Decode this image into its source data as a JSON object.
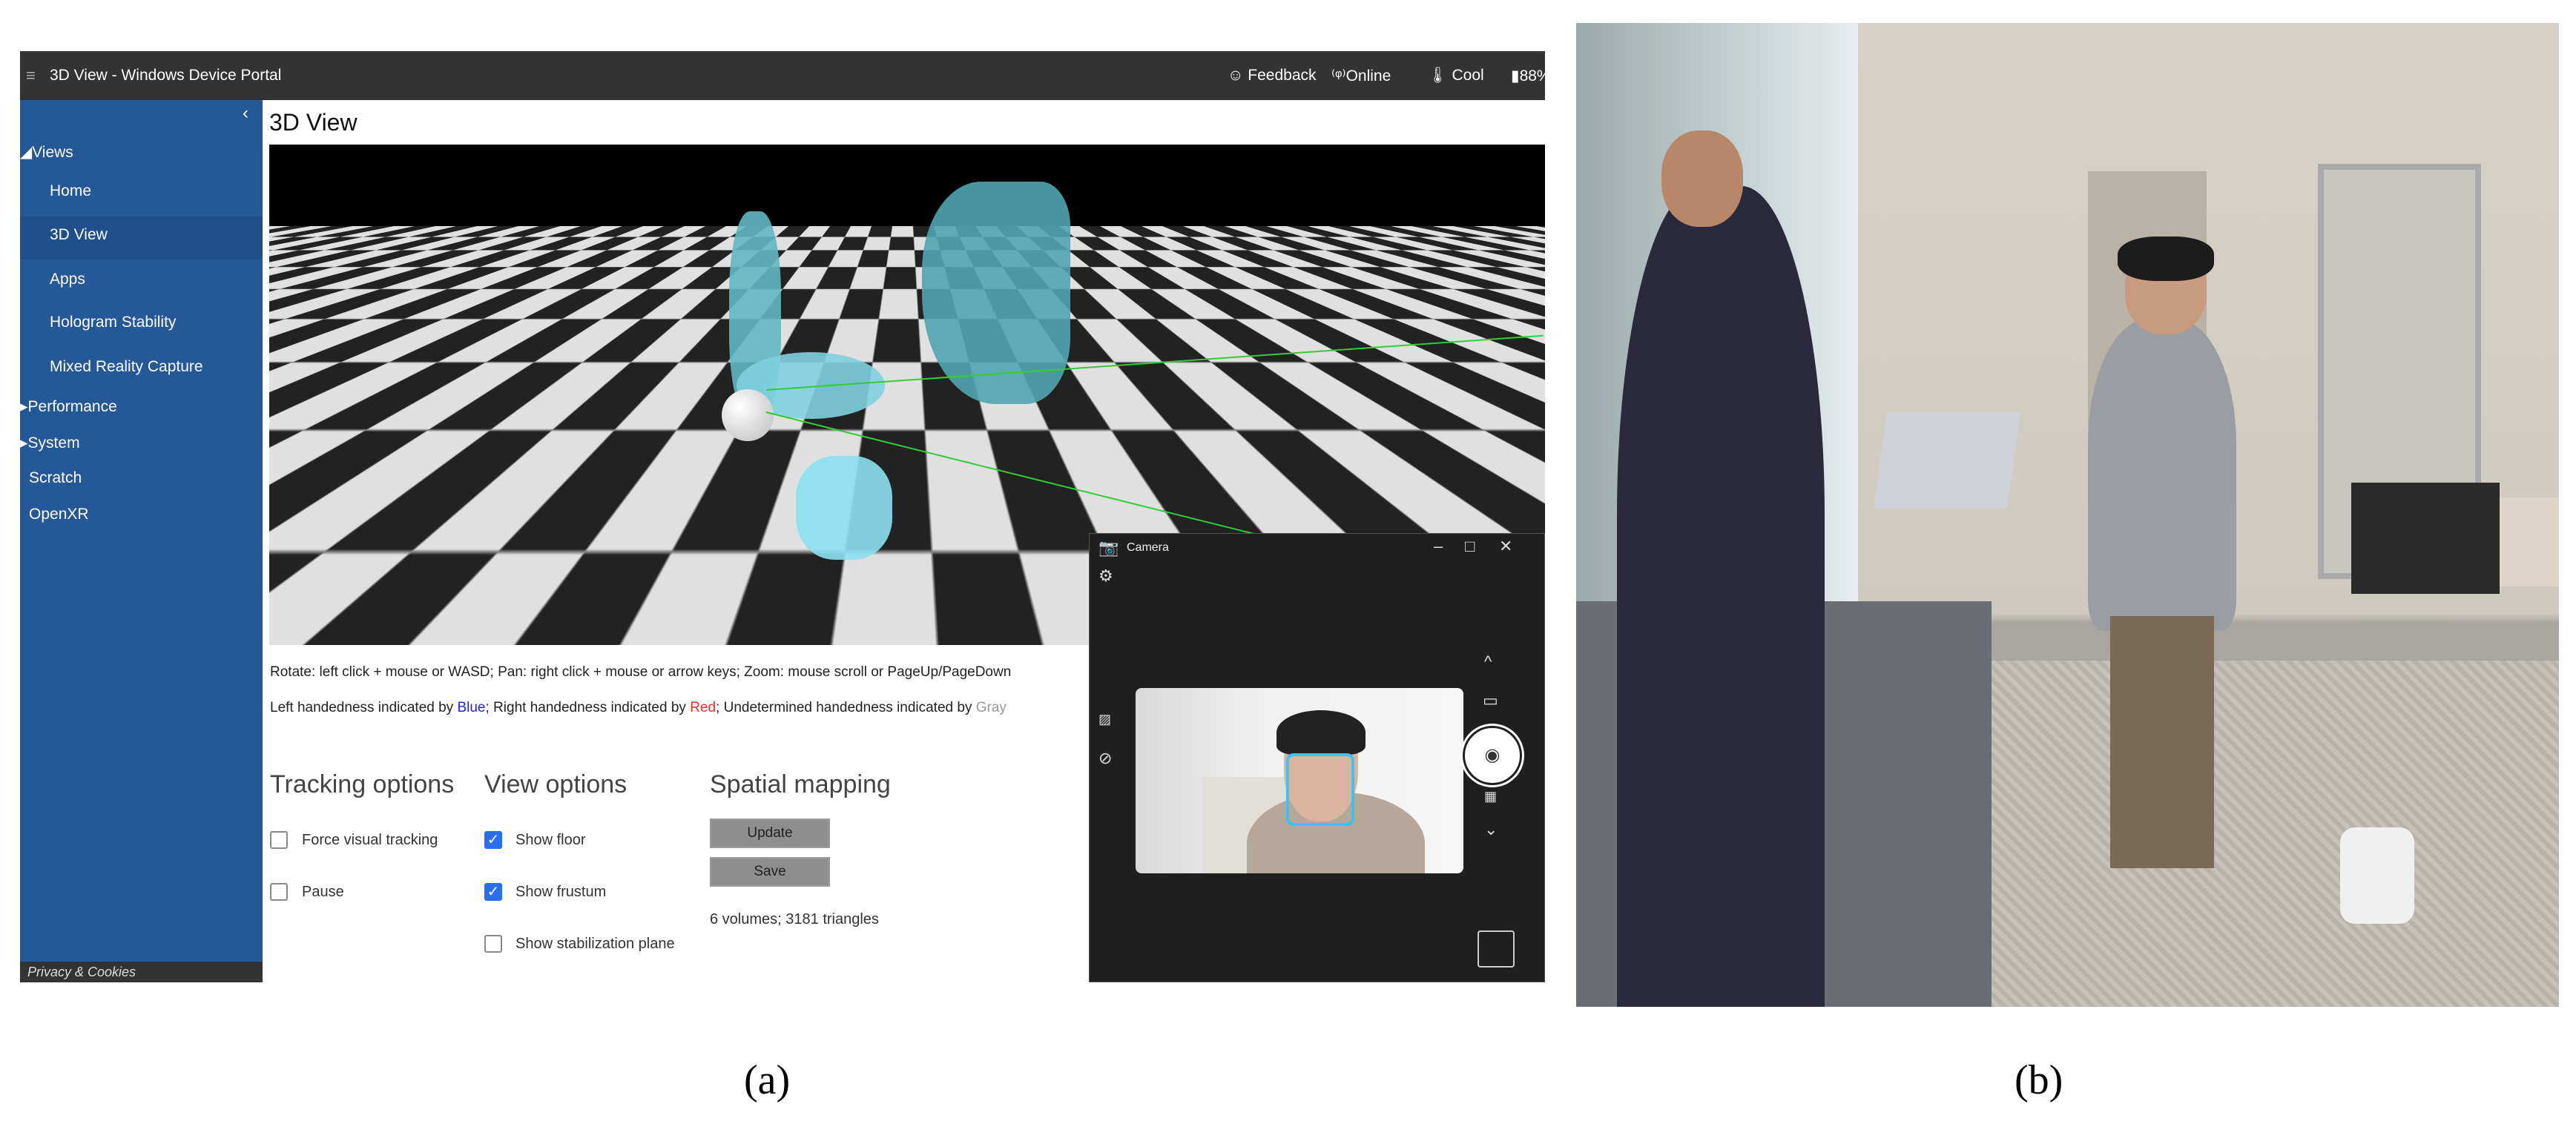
{
  "portal": {
    "title": "3D View - Windows Device Portal",
    "status": {
      "feedback": "Feedback",
      "online": "Online",
      "thermal": "Cool",
      "battery": "88%"
    },
    "sidebar": {
      "collapse_icon": "chevron-left-icon",
      "items": [
        {
          "label": "Views",
          "type": "group",
          "expanded": true
        },
        {
          "label": "Home"
        },
        {
          "label": "3D View",
          "selected": true
        },
        {
          "label": "Apps"
        },
        {
          "label": "Hologram Stability"
        },
        {
          "label": "Mixed Reality Capture"
        },
        {
          "label": "Performance",
          "type": "group",
          "expanded": false
        },
        {
          "label": "System",
          "type": "group",
          "expanded": false
        },
        {
          "label": "Scratch"
        },
        {
          "label": "OpenXR"
        }
      ],
      "footer": "Privacy & Cookies"
    },
    "page_title": "3D View",
    "instructions": "Rotate: left click + mouse or WASD; Pan: right click + mouse or arrow keys; Zoom: mouse scroll or PageUp/PageDown",
    "handedness": {
      "p1": "Left handedness indicated by ",
      "blue": "Blue",
      "p2": "; Right handedness indicated by ",
      "red": "Red",
      "p3": "; Undetermined handedness indicated by ",
      "gray": "Gray"
    },
    "tracking": {
      "heading": "Tracking options",
      "force_visual": {
        "label": "Force visual tracking",
        "checked": false
      },
      "pause": {
        "label": "Pause",
        "checked": false
      }
    },
    "view": {
      "heading": "View options",
      "show_floor": {
        "label": "Show floor",
        "checked": true
      },
      "show_frustum": {
        "label": "Show frustum",
        "checked": true
      },
      "show_stab": {
        "label": "Show stabilization plane",
        "checked": false
      }
    },
    "spatial": {
      "heading": "Spatial mapping",
      "update": "Update",
      "save": "Save",
      "stats": "6 volumes; 3181 triangles"
    }
  },
  "camera": {
    "title": "Camera",
    "check": "✓"
  },
  "colors": {
    "sidebar": "#255899",
    "topbar": "#333333",
    "blue": "#2222ee",
    "red": "#e53030",
    "gray": "#999999"
  },
  "captions": {
    "a": "(a)",
    "b": "(b)"
  }
}
